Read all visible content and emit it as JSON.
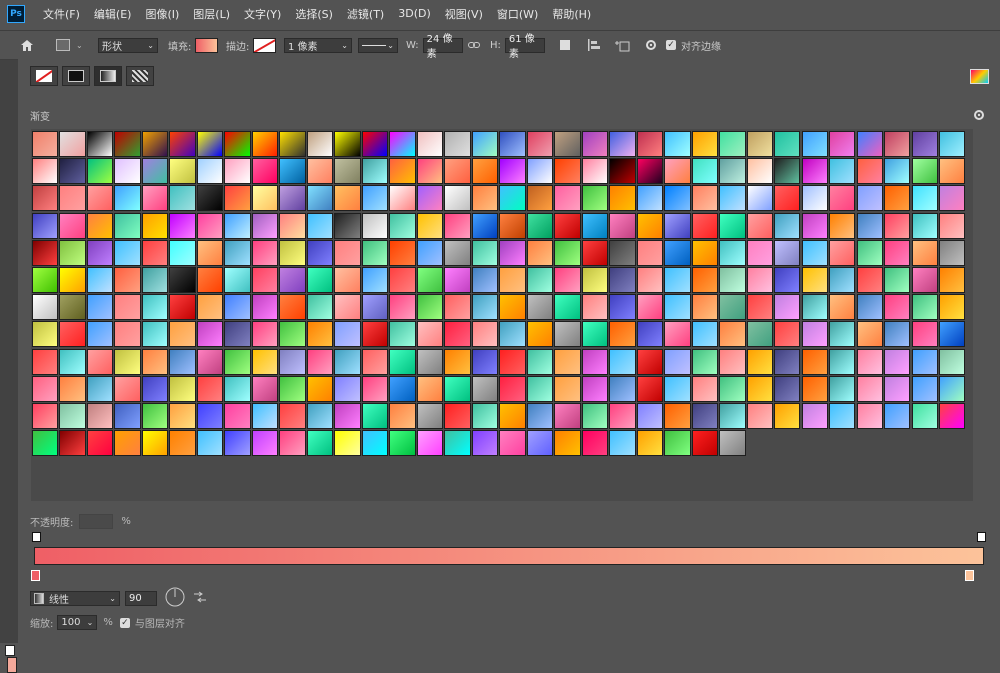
{
  "app": {
    "logo": "Ps",
    "menu": [
      "文件(F)",
      "编辑(E)",
      "图像(I)",
      "图层(L)",
      "文字(Y)",
      "选择(S)",
      "滤镜(T)",
      "3D(D)",
      "视图(V)",
      "窗口(W)",
      "帮助(H)"
    ]
  },
  "options": {
    "mode": "形状",
    "fill_label": "填充:",
    "stroke_label": "描边:",
    "stroke_width": "1 像素",
    "w_label": "W:",
    "w_value": "24 像素",
    "h_label": "H:",
    "h_value": "61 像素",
    "align_edges": "对齐边缘"
  },
  "panel": {
    "section_title": "渐变",
    "opacity_label": "不透明度:",
    "opacity_unit": "%",
    "style_value": "线性",
    "angle_value": "90",
    "scale_label": "缩放:",
    "scale_value": "100",
    "scale_unit": "%",
    "align_layer": "与图层对齐"
  },
  "colors": {
    "bg": "#535353",
    "gradient_start": "#ef5f66",
    "gradient_end": "#fcc39a"
  },
  "gradients": [
    [
      "#f0806a",
      "#f5b0a0"
    ],
    [
      "#e0e0e0",
      "#f2a0a0"
    ],
    [
      "#000000",
      "#ffffff"
    ],
    [
      "#c00000",
      "#30a030"
    ],
    [
      "#f0a000",
      "#301050"
    ],
    [
      "#ff4000",
      "#4000c0"
    ],
    [
      "#ffff00",
      "#0000ff"
    ],
    [
      "#ff0000",
      "#00ff00"
    ],
    [
      "#ffd000",
      "#ff2000"
    ],
    [
      "#ffe000",
      "#303030"
    ],
    [
      "#c0a080",
      "#ffffff"
    ],
    [
      "#ffff00",
      "#000000"
    ],
    [
      "#ff0000",
      "#0000ff"
    ],
    [
      "#ff00ff",
      "#00ffff"
    ],
    [
      "#f0c0c0",
      "#ffffff"
    ],
    [
      "#b0b0b0",
      "#e0e0e0"
    ],
    [
      "#40a0ff",
      "#a0ffc0"
    ],
    [
      "#3050c0",
      "#a0c0ff"
    ],
    [
      "#e04060",
      "#f0a0b0"
    ],
    [
      "#c0a080",
      "#606060"
    ],
    [
      "#a040c0",
      "#f080c0"
    ],
    [
      "#4060e0",
      "#f0b0f0"
    ],
    [
      "#c03050",
      "#ff8080"
    ],
    [
      "#40c0ff",
      "#a0ffff"
    ],
    [
      "#ffa000",
      "#ffe040"
    ],
    [
      "#40e0a0",
      "#a0f0c0"
    ],
    [
      "#c0a060",
      "#f0e0a0"
    ],
    [
      "#20c0a0",
      "#60e0c0"
    ],
    [
      "#40a0ff",
      "#80e0ff"
    ],
    [
      "#e040a0",
      "#f080f0"
    ],
    [
      "#4080ff",
      "#f060c0"
    ],
    [
      "#c04060",
      "#f0a0a0"
    ],
    [
      "#6040a0",
      "#a080e0"
    ],
    [
      "#40c0e0",
      "#a0f0ff"
    ],
    [
      "#ff8080",
      "#ffffff"
    ],
    [
      "#202040",
      "#6060a0"
    ],
    [
      "#00c080",
      "#a0ff40"
    ],
    [
      "#e0c0ff",
      "#ffffff"
    ],
    [
      "#a080e0",
      "#40c0a0"
    ],
    [
      "#ffff80",
      "#c0c040"
    ],
    [
      "#a0d0ff",
      "#ffffff"
    ],
    [
      "#ffa0c0",
      "#ffffff"
    ],
    [
      "#ff60a0",
      "#ff0060"
    ],
    [
      "#40c0ff",
      "#0060a0"
    ],
    [
      "#ffc0a0",
      "#ff8060"
    ],
    [
      "#c0c0a0",
      "#808060"
    ],
    [
      "#40a0a0",
      "#a0ffff"
    ],
    [
      "#ff6040",
      "#ffc000"
    ],
    [
      "#ff4080",
      "#ffc080"
    ],
    [
      "#ffa080",
      "#ff6040"
    ],
    [
      "#ffa040",
      "#ff6000"
    ],
    [
      "#a000ff",
      "#ff80ff"
    ],
    [
      "#80a0ff",
      "#ffffff"
    ],
    [
      "#ff4000",
      "#ff8060"
    ],
    [
      "#ff80a0",
      "#ffffff"
    ],
    [
      "#000000",
      "#c00000"
    ],
    [
      "#ff0060",
      "#200020"
    ],
    [
      "#ffa0c0",
      "#ff8040"
    ],
    [
      "#40e0c0",
      "#80ffff"
    ],
    [
      "#60a0a0",
      "#c0f0e0"
    ],
    [
      "#ffc0a0",
      "#ffffff"
    ],
    [
      "#202020",
      "#60c0a0"
    ],
    [
      "#c000c0",
      "#ff80ff"
    ],
    [
      "#40c0e0",
      "#a0e0ff"
    ],
    [
      "#ff6040",
      "#ff80a0"
    ],
    [
      "#40a0e0",
      "#a0ffff"
    ],
    [
      "#a0ffa0",
      "#40c040"
    ],
    [
      "#ffc080",
      "#ff8040"
    ],
    [
      "#c04040",
      "#ff8080"
    ],
    [
      "#ff8080",
      "#ffa0a0"
    ],
    [
      "#ffa0a0",
      "#ff6060"
    ],
    [
      "#40a0ff",
      "#80ffff"
    ],
    [
      "#ffa0c0",
      "#ff4080"
    ],
    [
      "#40c0c0",
      "#a0e0e0"
    ],
    [
      "#404040",
      "#000000"
    ],
    [
      "#ff4040",
      "#ffa040"
    ],
    [
      "#ffffa0",
      "#ffc060"
    ],
    [
      "#c0a0e0",
      "#6040a0"
    ],
    [
      "#80e0ff",
      "#4080c0"
    ],
    [
      "#ffc060",
      "#ff8040"
    ],
    [
      "#40a0ff",
      "#a0e0ff"
    ],
    [
      "#ffffff",
      "#ff8080"
    ],
    [
      "#a060ff",
      "#ff80c0"
    ],
    [
      "#ffffff",
      "#c0c0c0"
    ],
    [
      "#ff8040",
      "#ffc080"
    ],
    [
      "#40c0ff",
      "#00ffc0"
    ],
    [
      "#c06020",
      "#ffa040"
    ],
    [
      "#ff60a0",
      "#ffa0c0"
    ],
    [
      "#40c040",
      "#a0ff80"
    ],
    [
      "#ff8000",
      "#ffc000"
    ],
    [
      "#40a0ff",
      "#c0e0ff"
    ],
    [
      "#0080ff",
      "#80c0ff"
    ],
    [
      "#ff8060",
      "#ffc0a0"
    ],
    [
      "#40c0ff",
      "#c0e0ff"
    ],
    [
      "#ffffff",
      "#80a0ff"
    ],
    [
      "#ff6060",
      "#ff2020"
    ],
    [
      "#a0c0ff",
      "#ffffff"
    ],
    [
      "#ff80a0",
      "#ff4080"
    ],
    [
      "#80a0ff",
      "#c0c0ff"
    ],
    [
      "#ff6000",
      "#ffa040"
    ],
    [
      "#40e0ff",
      "#a0ffff"
    ],
    [
      "#c080e0",
      "#ff80c0"
    ],
    [
      "#4040c0",
      "#a0a0ff"
    ],
    [
      "#ff80c0",
      "#ff4080"
    ],
    [
      "#ff8040",
      "#ffc000"
    ],
    [
      "#40c0a0",
      "#80ffc0"
    ],
    [
      "#ffa000",
      "#ffe000"
    ],
    [
      "#c000ff",
      "#ff80ff"
    ],
    [
      "#ff40a0",
      "#ffa0c0"
    ],
    [
      "#40a0ff",
      "#c0f0ff"
    ],
    [
      "#a060c0",
      "#ffa0ff"
    ],
    [
      "#ff8080",
      "#ffe0a0"
    ],
    [
      "#40c0ff",
      "#a0e0ff"
    ],
    [
      "#202020",
      "#808080"
    ],
    [
      "#c0c0c0",
      "#ffffff"
    ],
    [
      "#40c0a0",
      "#a0ffe0"
    ],
    [
      "#ffc000",
      "#ffe080"
    ],
    [
      "#ff4080",
      "#ffa0c0"
    ],
    [
      "#40a0ff",
      "#0040c0"
    ],
    [
      "#ff8040",
      "#c04000"
    ],
    [
      "#40e0a0",
      "#00a060"
    ],
    [
      "#ff4040",
      "#c00000"
    ],
    [
      "#40c0ff",
      "#0080c0"
    ],
    [
      "#ff80c0",
      "#c04080"
    ],
    [
      "#ffc000",
      "#ff8000"
    ],
    [
      "#a0a0ff",
      "#4040c0"
    ],
    [
      "#ff6060",
      "#ff2020"
    ],
    [
      "#40ffc0",
      "#00c080"
    ],
    [
      "#ffa0a0",
      "#ff6060"
    ],
    [
      "#40a0c0",
      "#a0e0ff"
    ],
    [
      "#c040c0",
      "#ff80ff"
    ],
    [
      "#ff8000",
      "#ffc080"
    ],
    [
      "#4080c0",
      "#a0c0ff"
    ],
    [
      "#ff4060",
      "#ffa0a0"
    ],
    [
      "#40c0c0",
      "#a0ffff"
    ],
    [
      "#ff8080",
      "#ffc0c0"
    ],
    [
      "#800000",
      "#ff4040"
    ],
    [
      "#80c040",
      "#c0ff80"
    ],
    [
      "#8040c0",
      "#c080ff"
    ],
    [
      "#40c0ff",
      "#a0e0ff"
    ],
    [
      "#ff4040",
      "#ff8080"
    ],
    [
      "#40ffff",
      "#a0ffff"
    ],
    [
      "#ffc080",
      "#ff8040"
    ],
    [
      "#40a0c0",
      "#a0e0ff"
    ],
    [
      "#ff4080",
      "#ffa0c0"
    ],
    [
      "#c0c040",
      "#ffff80"
    ],
    [
      "#4040c0",
      "#8080ff"
    ],
    [
      "#ff8080",
      "#ffa0a0"
    ],
    [
      "#40c080",
      "#a0ffc0"
    ],
    [
      "#ff4000",
      "#ff8040"
    ],
    [
      "#40a0ff",
      "#a0c0ff"
    ],
    [
      "#c0c0c0",
      "#808080"
    ],
    [
      "#40c0a0",
      "#a0ffe0"
    ],
    [
      "#a040c0",
      "#ff80ff"
    ],
    [
      "#ff8040",
      "#ffc080"
    ],
    [
      "#40c040",
      "#a0ff80"
    ],
    [
      "#ff4040",
      "#c00000"
    ],
    [
      "#404040",
      "#808080"
    ],
    [
      "#ff8080",
      "#ffa0a0"
    ],
    [
      "#40a0ff",
      "#0060c0"
    ],
    [
      "#ffc000",
      "#ff8000"
    ],
    [
      "#40c0c0",
      "#a0ffff"
    ],
    [
      "#ff80c0",
      "#ffa0e0"
    ],
    [
      "#c0c0ff",
      "#8080c0"
    ],
    [
      "#40c0ff",
      "#a0e0ff"
    ],
    [
      "#ffa0a0",
      "#ff6060"
    ],
    [
      "#40c080",
      "#a0ffc0"
    ],
    [
      "#ff4080",
      "#ff80c0"
    ],
    [
      "#ffc080",
      "#ff8040"
    ],
    [
      "#808080",
      "#c0c0c0"
    ],
    [
      "#a0ff40",
      "#40c000"
    ],
    [
      "#ffff00",
      "#ffa000"
    ],
    [
      "#40c0ff",
      "#c0e0ff"
    ],
    [
      "#ff6040",
      "#ffa080"
    ],
    [
      "#40a0a0",
      "#a0e0e0"
    ],
    [
      "#404040",
      "#000000"
    ],
    [
      "#ff8040",
      "#ff4000"
    ],
    [
      "#a0ffff",
      "#40c0c0"
    ],
    [
      "#ff4060",
      "#ff80a0"
    ],
    [
      "#c080e0",
      "#8040c0"
    ],
    [
      "#40ffc0",
      "#00c080"
    ],
    [
      "#ffc0a0",
      "#ff8060"
    ],
    [
      "#40a0ff",
      "#a0e0ff"
    ],
    [
      "#ff4040",
      "#ff8080"
    ],
    [
      "#80ff80",
      "#40c040"
    ],
    [
      "#ff80ff",
      "#c040c0"
    ],
    [
      "#4080c0",
      "#a0c0ff"
    ],
    [
      "#ffa040",
      "#ffc080"
    ],
    [
      "#40c0a0",
      "#a0ffe0"
    ],
    [
      "#ff4080",
      "#ffa0c0"
    ],
    [
      "#c0c040",
      "#ffff80"
    ],
    [
      "#404080",
      "#8080c0"
    ],
    [
      "#ff8080",
      "#ffc0c0"
    ],
    [
      "#40c0ff",
      "#a0e0ff"
    ],
    [
      "#ff6000",
      "#ffa040"
    ],
    [
      "#80c0a0",
      "#c0ffe0"
    ],
    [
      "#ff80a0",
      "#ffc0e0"
    ],
    [
      "#4040c0",
      "#8080ff"
    ],
    [
      "#ffc000",
      "#ffe080"
    ],
    [
      "#40a0c0",
      "#a0e0ff"
    ],
    [
      "#ff4040",
      "#ff8080"
    ],
    [
      "#40c080",
      "#a0ffc0"
    ],
    [
      "#ff80c0",
      "#c04080"
    ],
    [
      "#ff8000",
      "#ffc040"
    ],
    [
      "#ffffff",
      "#c0c0c0"
    ],
    [
      "#a0a060",
      "#606020"
    ],
    [
      "#40a0ff",
      "#a0c0ff"
    ],
    [
      "#ff8080",
      "#ffa0a0"
    ],
    [
      "#40c0c0",
      "#a0ffff"
    ],
    [
      "#ff4040",
      "#c00000"
    ],
    [
      "#ffa040",
      "#ffc080"
    ],
    [
      "#4080ff",
      "#a0c0ff"
    ],
    [
      "#c040c0",
      "#ff80ff"
    ],
    [
      "#ff8040",
      "#ff4000"
    ],
    [
      "#40c0a0",
      "#a0ffe0"
    ],
    [
      "#ffc0c0",
      "#ff8080"
    ],
    [
      "#a0a0ff",
      "#6060c0"
    ],
    [
      "#ff4080",
      "#ffa0c0"
    ],
    [
      "#40c040",
      "#a0ff80"
    ],
    [
      "#ff6060",
      "#ffa0a0"
    ],
    [
      "#40a0c0",
      "#a0e0ff"
    ],
    [
      "#ffc000",
      "#ff8000"
    ],
    [
      "#c0c0c0",
      "#808080"
    ],
    [
      "#40ffc0",
      "#00c080"
    ],
    [
      "#ff8080",
      "#ffc0c0"
    ],
    [
      "#4040c0",
      "#8080ff"
    ],
    [
      "#ffa0c0",
      "#ff4080"
    ],
    [
      "#40c0ff",
      "#a0e0ff"
    ],
    [
      "#ff8040",
      "#ffc080"
    ],
    [
      "#80c0a0",
      "#40a080"
    ],
    [
      "#ff4040",
      "#ff8080"
    ],
    [
      "#c080e0",
      "#ffa0ff"
    ],
    [
      "#40a0a0",
      "#a0ffff"
    ],
    [
      "#ffc080",
      "#ff8040"
    ],
    [
      "#4080c0",
      "#a0c0ff"
    ],
    [
      "#ff4080",
      "#ff80c0"
    ],
    [
      "#40c080",
      "#a0ffc0"
    ],
    [
      "#ffa000",
      "#ffe040"
    ],
    [
      "#c0c040",
      "#ffff80"
    ],
    [
      "#ff6060",
      "#ff2020"
    ],
    [
      "#40a0ff",
      "#a0c0ff"
    ],
    [
      "#ff8080",
      "#ffa0a0"
    ],
    [
      "#40c0c0",
      "#a0ffff"
    ],
    [
      "#ffa040",
      "#ffc080"
    ],
    [
      "#c040c0",
      "#ff80ff"
    ],
    [
      "#404080",
      "#8080c0"
    ],
    [
      "#ff4080",
      "#ffa0c0"
    ],
    [
      "#40c040",
      "#a0ff80"
    ],
    [
      "#ff8000",
      "#ffc040"
    ],
    [
      "#80a0ff",
      "#c0c0ff"
    ],
    [
      "#ff4040",
      "#c00000"
    ],
    [
      "#40c0a0",
      "#a0ffe0"
    ],
    [
      "#ffc0c0",
      "#ff8080"
    ],
    [
      "#ff2040",
      "#ff6080"
    ],
    [
      "#ff8080",
      "#ffc0c0"
    ],
    [
      "#40a0c0",
      "#a0e0ff"
    ],
    [
      "#ffc000",
      "#ff8000"
    ],
    [
      "#c0c0c0",
      "#808080"
    ],
    [
      "#40ffc0",
      "#00c080"
    ],
    [
      "#ff6000",
      "#ffa040"
    ],
    [
      "#4040c0",
      "#8080ff"
    ],
    [
      "#ffa0c0",
      "#ff4080"
    ],
    [
      "#40c0ff",
      "#a0e0ff"
    ],
    [
      "#ff8040",
      "#ffc080"
    ],
    [
      "#80c0a0",
      "#40a080"
    ],
    [
      "#ff4040",
      "#ff8080"
    ],
    [
      "#c080e0",
      "#ffa0ff"
    ],
    [
      "#40a0a0",
      "#a0ffff"
    ],
    [
      "#ffc080",
      "#ff8040"
    ],
    [
      "#4080c0",
      "#a0c0ff"
    ],
    [
      "#ff4080",
      "#ff80c0"
    ],
    [
      "#40a0ff",
      "#0040c0"
    ],
    [
      "#ff4040",
      "#ff8080"
    ],
    [
      "#40c0c0",
      "#a0ffff"
    ],
    [
      "#ffa0a0",
      "#ff6060"
    ],
    [
      "#c0c040",
      "#ffff80"
    ],
    [
      "#ff8040",
      "#ffc080"
    ],
    [
      "#4080c0",
      "#a0c0ff"
    ],
    [
      "#ff80c0",
      "#c04080"
    ],
    [
      "#40c040",
      "#a0ff80"
    ],
    [
      "#ffc000",
      "#ffe080"
    ],
    [
      "#8080c0",
      "#c0c0ff"
    ],
    [
      "#ff4080",
      "#ffa0c0"
    ],
    [
      "#40a0c0",
      "#a0e0ff"
    ],
    [
      "#ff6060",
      "#ffa0a0"
    ],
    [
      "#40ffc0",
      "#00c080"
    ],
    [
      "#c0c0c0",
      "#808080"
    ],
    [
      "#ff8000",
      "#ffc040"
    ],
    [
      "#4040c0",
      "#8080ff"
    ],
    [
      "#ff2020",
      "#ff6060"
    ],
    [
      "#40c0a0",
      "#a0ffe0"
    ],
    [
      "#ffa040",
      "#ffc080"
    ],
    [
      "#c040c0",
      "#ff80ff"
    ],
    [
      "#40c0ff",
      "#a0e0ff"
    ],
    [
      "#ff4040",
      "#c00000"
    ],
    [
      "#80a0ff",
      "#c0c0ff"
    ],
    [
      "#40c080",
      "#a0ffc0"
    ],
    [
      "#ff8080",
      "#ffc0c0"
    ],
    [
      "#ffa000",
      "#ffe040"
    ],
    [
      "#404080",
      "#8080c0"
    ],
    [
      "#ff6000",
      "#ffa040"
    ],
    [
      "#40a0a0",
      "#a0ffff"
    ],
    [
      "#ff80a0",
      "#ffc0e0"
    ],
    [
      "#c080e0",
      "#ffa0ff"
    ],
    [
      "#40a0ff",
      "#a0c0ff"
    ],
    [
      "#80c0a0",
      "#c0ffe0"
    ],
    [
      "#ff6080",
      "#ffa0c0"
    ],
    [
      "#ff8040",
      "#ffc080"
    ],
    [
      "#40a0c0",
      "#a0e0ff"
    ],
    [
      "#ffa0a0",
      "#ff6060"
    ],
    [
      "#4040c0",
      "#8080ff"
    ],
    [
      "#c0c040",
      "#ffff80"
    ],
    [
      "#ff4040",
      "#ff8080"
    ],
    [
      "#40c0c0",
      "#a0ffff"
    ],
    [
      "#ff80c0",
      "#c04080"
    ],
    [
      "#40c040",
      "#a0ff80"
    ],
    [
      "#ffc000",
      "#ff8000"
    ],
    [
      "#8080ff",
      "#c0c0ff"
    ],
    [
      "#ff4080",
      "#ffa0c0"
    ],
    [
      "#40a0ff",
      "#0060c0"
    ],
    [
      "#ffc080",
      "#ff8040"
    ],
    [
      "#40ffc0",
      "#00c080"
    ],
    [
      "#c0c0c0",
      "#808080"
    ],
    [
      "#ff2040",
      "#ff6080"
    ],
    [
      "#40c0a0",
      "#a0ffe0"
    ],
    [
      "#ffa040",
      "#ffc080"
    ],
    [
      "#c040c0",
      "#ff80ff"
    ],
    [
      "#4080c0",
      "#a0c0ff"
    ],
    [
      "#ff4040",
      "#c00000"
    ],
    [
      "#40c0ff",
      "#a0e0ff"
    ],
    [
      "#ff8080",
      "#ffc0c0"
    ],
    [
      "#40c080",
      "#a0ffc0"
    ],
    [
      "#ffa000",
      "#ffe040"
    ],
    [
      "#404080",
      "#8080c0"
    ],
    [
      "#ff6000",
      "#ffa040"
    ],
    [
      "#40a0a0",
      "#a0ffff"
    ],
    [
      "#ff80a0",
      "#ffc0e0"
    ],
    [
      "#c080e0",
      "#ffa0ff"
    ],
    [
      "#40a0ff",
      "#a0c0ff"
    ],
    [
      "#40a0ff",
      "#a0ffc0"
    ],
    [
      "#ff4060",
      "#ffa0a0"
    ],
    [
      "#80c0a0",
      "#c0ffe0"
    ],
    [
      "#c08080",
      "#ffc0c0"
    ],
    [
      "#4060c0",
      "#80a0ff"
    ],
    [
      "#40c040",
      "#a0ff80"
    ],
    [
      "#ffa040",
      "#ffe080"
    ],
    [
      "#4040ff",
      "#8080ff"
    ],
    [
      "#ff40a0",
      "#ff80c0"
    ],
    [
      "#40c0ff",
      "#c0e0ff"
    ],
    [
      "#ff4040",
      "#ff8080"
    ],
    [
      "#40a0c0",
      "#a0e0ff"
    ],
    [
      "#c040c0",
      "#ff80ff"
    ],
    [
      "#40ffc0",
      "#00c080"
    ],
    [
      "#ff8040",
      "#ffc080"
    ],
    [
      "#c0c0c0",
      "#808080"
    ],
    [
      "#ff2020",
      "#ff6060"
    ],
    [
      "#40c0a0",
      "#a0ffe0"
    ],
    [
      "#ffc000",
      "#ff8000"
    ],
    [
      "#4080c0",
      "#a0c0ff"
    ],
    [
      "#ff80c0",
      "#c04080"
    ],
    [
      "#40c080",
      "#a0ffc0"
    ],
    [
      "#ff4080",
      "#ffa0c0"
    ],
    [
      "#8080ff",
      "#c0c0ff"
    ],
    [
      "#ff6000",
      "#ffa040"
    ],
    [
      "#404080",
      "#8080c0"
    ],
    [
      "#40a0a0",
      "#a0ffff"
    ],
    [
      "#ff8080",
      "#ffc0c0"
    ],
    [
      "#ffa000",
      "#ffe040"
    ],
    [
      "#c080e0",
      "#ffa0ff"
    ],
    [
      "#40c0ff",
      "#a0e0ff"
    ],
    [
      "#ff80a0",
      "#ffc0e0"
    ],
    [
      "#40a0ff",
      "#a0c0ff"
    ],
    [
      "#40e0a0",
      "#a0ffe0"
    ],
    [
      "#ff4040",
      "#ff00ff"
    ],
    [
      "#40c040",
      "#00ff80"
    ],
    [
      "#800000",
      "#ff4040"
    ],
    [
      "#ff4040",
      "#ff0040"
    ],
    [
      "#ffa000",
      "#ff8040"
    ],
    [
      "#ffff00",
      "#ffa000"
    ],
    [
      "#ff8000",
      "#ffa040"
    ],
    [
      "#40c0ff",
      "#a0e0ff"
    ],
    [
      "#4040ff",
      "#a0a0ff"
    ],
    [
      "#c040ff",
      "#ff80ff"
    ],
    [
      "#ff4080",
      "#ffa0c0"
    ],
    [
      "#40ffc0",
      "#00c080"
    ],
    [
      "#ffff00",
      "#ffffa0"
    ],
    [
      "#40c0ff",
      "#00ffff"
    ],
    [
      "#40ff80",
      "#00c040"
    ],
    [
      "#ffa0ff",
      "#ff40ff"
    ],
    [
      "#40c0a0",
      "#00ffff"
    ],
    [
      "#8040ff",
      "#c080ff"
    ],
    [
      "#ff80c0",
      "#ff40a0"
    ],
    [
      "#a0a0ff",
      "#6060ff"
    ],
    [
      "#ff8000",
      "#ffc000"
    ],
    [
      "#ff0060",
      "#ff4080"
    ],
    [
      "#40c0ff",
      "#a0e0ff"
    ],
    [
      "#ffa000",
      "#ffe040"
    ],
    [
      "#40c040",
      "#80ff80"
    ],
    [
      "#ff2020",
      "#c00000"
    ],
    [
      "#c0c0c0",
      "#808080"
    ]
  ]
}
